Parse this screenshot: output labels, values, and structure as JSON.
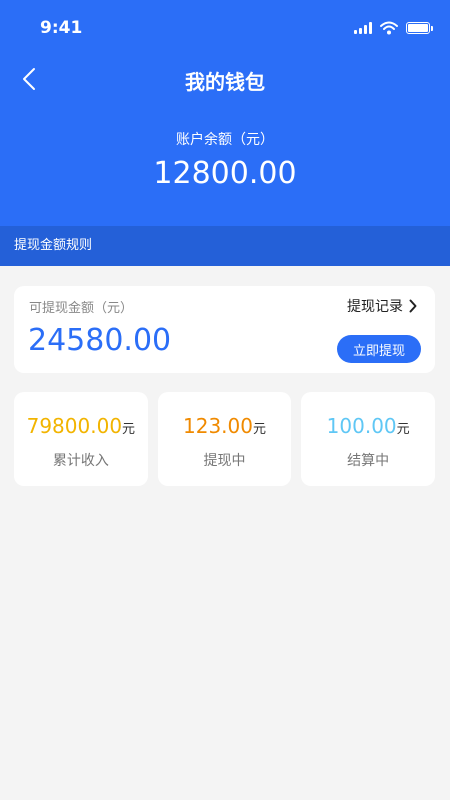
{
  "status_bar": {
    "time": "9:41"
  },
  "nav": {
    "title": "我的钱包"
  },
  "account": {
    "balance_label": "账户余额（元）",
    "balance_value": "12800.00"
  },
  "rules": {
    "label": "提现金额规则"
  },
  "withdraw": {
    "label": "可提现金额（元）",
    "amount": "24580.00",
    "record_label": "提现记录",
    "button_label": "立即提现"
  },
  "stats": [
    {
      "value": "79800.00",
      "unit": "元",
      "label": "累计收入",
      "color": "#f2b400"
    },
    {
      "value": "123.00",
      "unit": "元",
      "label": "提现中",
      "color": "#f08a00"
    },
    {
      "value": "100.00",
      "unit": "元",
      "label": "结算中",
      "color": "#5fc7f5"
    }
  ],
  "colors": {
    "primary": "#2b6ef7",
    "rules_bar": "#2460d8",
    "background": "#f4f4f4"
  },
  "icons": [
    "back-chevron-icon",
    "signal-icon",
    "wifi-icon",
    "battery-icon",
    "chevron-right-icon"
  ]
}
